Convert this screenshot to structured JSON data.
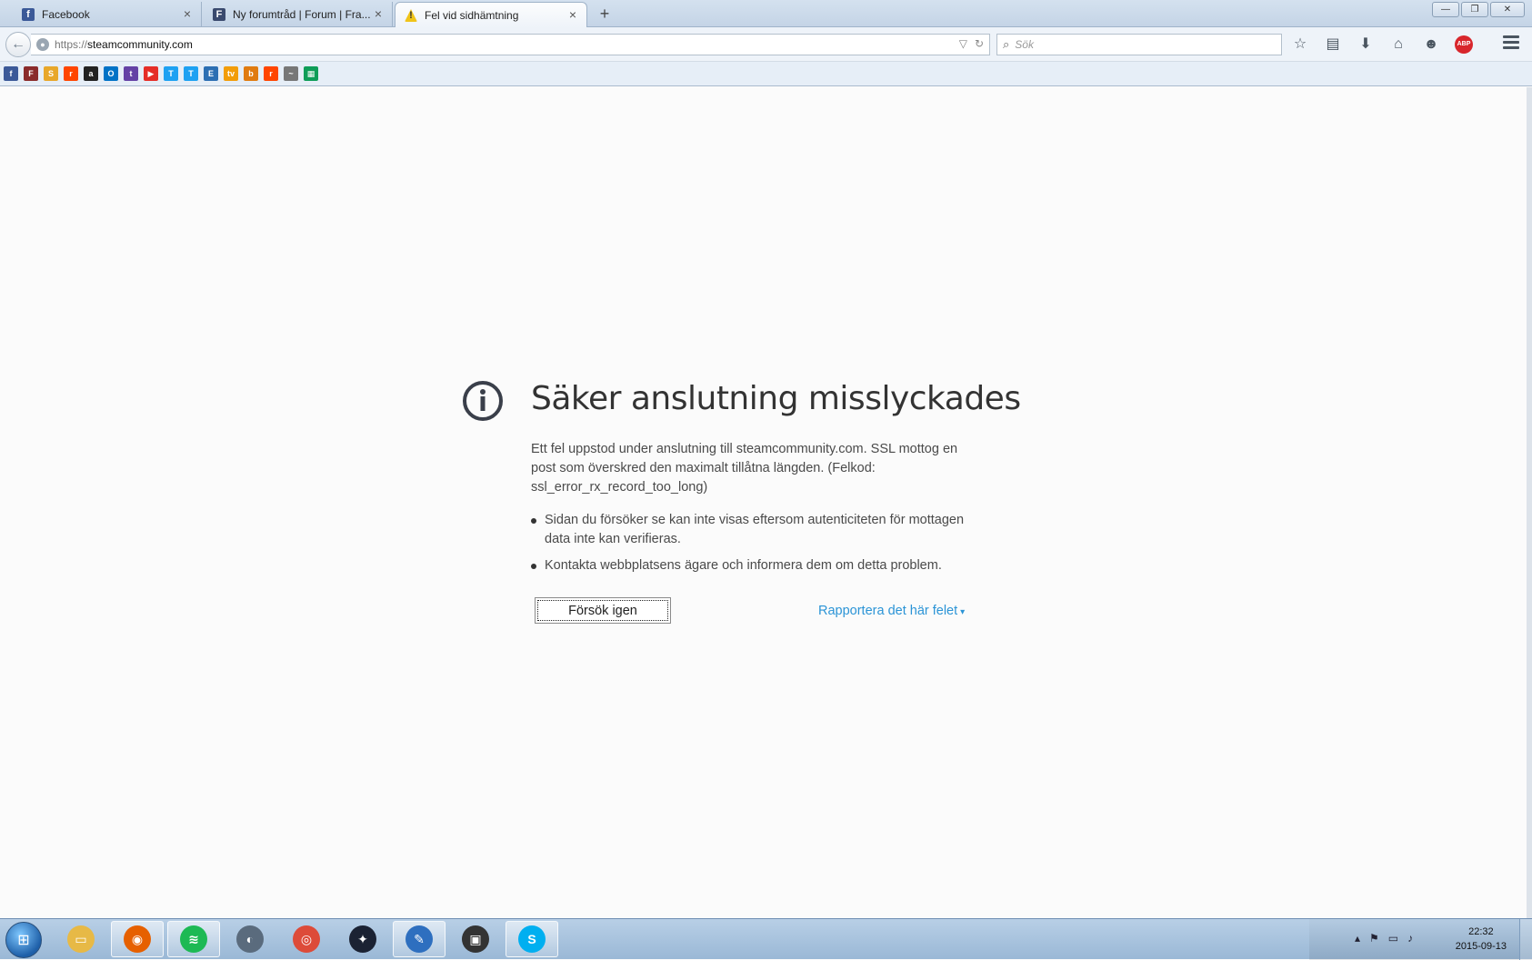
{
  "tabs": [
    {
      "label": "Facebook",
      "favicon": "facebook-icon",
      "color": "#3b5998",
      "glyph": "f"
    },
    {
      "label": "Ny forumtråd | Forum | Fra...",
      "favicon": "forum-icon",
      "color": "#3a4a6e",
      "glyph": "F"
    },
    {
      "label": "Fel vid sidhämtning",
      "favicon": "warning-icon",
      "color": "#f0c419",
      "glyph": "!"
    }
  ],
  "close_glyph": "×",
  "new_tab_glyph": "+",
  "window_buttons": {
    "minimize": "—",
    "restore": "❐",
    "close": "✕"
  },
  "navbar": {
    "url_scheme": "https://",
    "url_host": "steamcommunity.com",
    "search_placeholder": "Sök",
    "back_glyph": "←",
    "search_glyph": "⌕"
  },
  "navbar_icons": [
    {
      "name": "bookmark-star-icon",
      "glyph": "☆"
    },
    {
      "name": "bookmarks-list-icon",
      "glyph": "▤"
    },
    {
      "name": "downloads-icon",
      "glyph": "⬇"
    },
    {
      "name": "home-icon",
      "glyph": "⌂"
    },
    {
      "name": "chat-icon",
      "glyph": "☻"
    }
  ],
  "abp_label": "ABP",
  "bookmarks": [
    {
      "name": "facebook-icon",
      "color": "#3b5998",
      "glyph": "f"
    },
    {
      "name": "forum-icon",
      "color": "#8a2b2b",
      "glyph": "F"
    },
    {
      "name": "steam-icon",
      "color": "#e8a72a",
      "glyph": "S"
    },
    {
      "name": "reddit-icon",
      "color": "#ff4500",
      "glyph": "r"
    },
    {
      "name": "amazon-icon",
      "color": "#222222",
      "glyph": "a"
    },
    {
      "name": "outlook-icon",
      "color": "#0072c6",
      "glyph": "O"
    },
    {
      "name": "twitch-icon",
      "color": "#6441a5",
      "glyph": "t"
    },
    {
      "name": "youtube-icon",
      "color": "#e52d27",
      "glyph": "▶"
    },
    {
      "name": "tweetdeck-icon",
      "color": "#1da1f2",
      "glyph": "T"
    },
    {
      "name": "tweetdeck-icon-2",
      "color": "#1da1f2",
      "glyph": "T"
    },
    {
      "name": "el-icon",
      "color": "#2c6fb3",
      "glyph": "E"
    },
    {
      "name": "tv-icon",
      "color": "#f29d0a",
      "glyph": "tv"
    },
    {
      "name": "bookmark-icon",
      "color": "#e07b10",
      "glyph": "b"
    },
    {
      "name": "reddit-icon-2",
      "color": "#ff4500",
      "glyph": "r"
    },
    {
      "name": "graph-icon",
      "color": "#777777",
      "glyph": "~"
    },
    {
      "name": "sheets-icon",
      "color": "#0f9d58",
      "glyph": "▦"
    }
  ],
  "error": {
    "title": "Säker anslutning misslyckades",
    "description": "Ett fel uppstod under anslutning till steamcommunity.com. SSL mottog en post som överskred den maximalt tillåtna längden. (Felkod: ssl_error_rx_record_too_long)",
    "bullets": [
      "Sidan du försöker se kan inte visas eftersom autenticiteten för mottagen data inte kan verifieras.",
      "Kontakta webbplatsens ägare och informera dem om detta problem."
    ],
    "retry_label": "Försök igen",
    "report_label": "Rapportera det här felet",
    "report_caret": "▾",
    "link_color": "#2b94d6"
  },
  "taskbar": {
    "start_glyph": "⊞",
    "items": [
      {
        "name": "explorer-icon",
        "color": "#e7b946",
        "glyph": "▭",
        "active": false
      },
      {
        "name": "firefox-icon",
        "color": "#e66000",
        "glyph": "◉",
        "active": true
      },
      {
        "name": "spotify-icon",
        "color": "#1db954",
        "glyph": "≋",
        "active": true
      },
      {
        "name": "teamspeak-icon",
        "color": "#5a6b7d",
        "glyph": "◐",
        "active": false
      },
      {
        "name": "chrome-icon",
        "color": "#dd4b39",
        "glyph": "◎",
        "active": false
      },
      {
        "name": "game-icon",
        "color": "#1b2233",
        "glyph": "✦",
        "active": false
      },
      {
        "name": "paint-icon",
        "color": "#2e6fbf",
        "glyph": "✎",
        "active": true
      },
      {
        "name": "media-icon",
        "color": "#333333",
        "glyph": "▣",
        "active": false
      },
      {
        "name": "skype-icon",
        "color": "#00aff0",
        "glyph": "S",
        "active": true
      }
    ],
    "tray_icons": [
      {
        "name": "tray-arrow-icon",
        "glyph": "▴"
      },
      {
        "name": "tray-flag-icon",
        "glyph": "⚑"
      },
      {
        "name": "tray-network-icon",
        "glyph": "▭"
      },
      {
        "name": "tray-volume-icon",
        "glyph": "♪"
      }
    ],
    "time": "22:32",
    "date": "2015-09-13"
  }
}
